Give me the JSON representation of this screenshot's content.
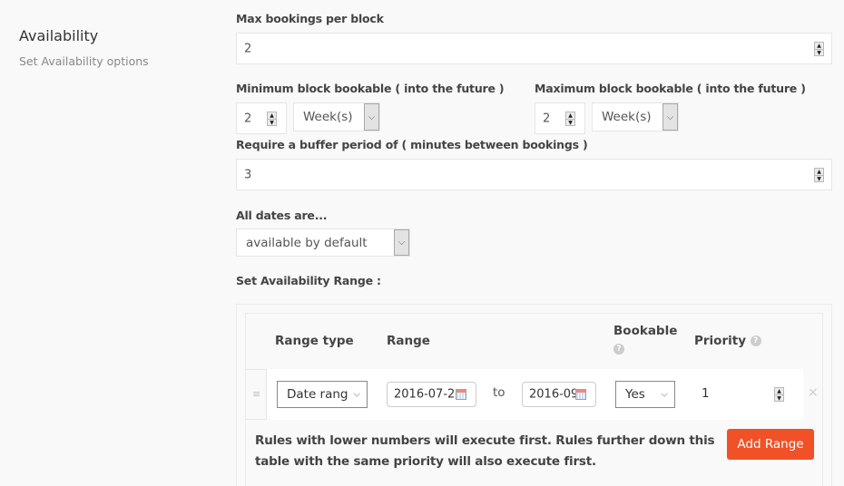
{
  "section": {
    "title": "Availability",
    "description": "Set Availability options"
  },
  "max_bookings": {
    "label": "Max bookings per block",
    "value": "2"
  },
  "min_block": {
    "label": "Minimum block bookable ( into the future )",
    "value": "2",
    "unit": "Week(s)"
  },
  "max_block": {
    "label": "Maximum block bookable ( into the future )",
    "value": "2",
    "unit": "Week(s)"
  },
  "buffer": {
    "label": "Require a buffer period of ( minutes between bookings )",
    "value": "3"
  },
  "all_dates": {
    "label": "All dates are...",
    "value": "available by default"
  },
  "range": {
    "label": "Set Availability Range :",
    "headers": {
      "range_type": "Range type",
      "range": "Range",
      "bookable": "Bookable",
      "priority": "Priority"
    },
    "rows": [
      {
        "range_type": "Date rang",
        "from": "2016-07-2",
        "to_label": "to",
        "to": "2016-09",
        "bookable": "Yes",
        "priority": "1"
      }
    ],
    "note": "Rules with lower numbers will execute first. Rules further down this table with the same priority will also execute first.",
    "add_button": "Add Range"
  },
  "icons": {
    "help": "?",
    "drag": "≡",
    "remove": "×",
    "chevron": "⌵",
    "up": "▲",
    "down": "▼"
  },
  "colors": {
    "accent": "#f15127"
  }
}
